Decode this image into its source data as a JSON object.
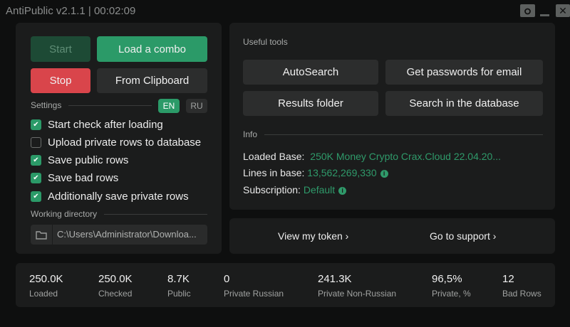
{
  "window": {
    "title": "AntiPublic v2.1.1 | 00:02:09",
    "minimize": "_",
    "close": "✕"
  },
  "left": {
    "start": "Start",
    "load_combo": "Load a combo",
    "stop": "Stop",
    "from_clipboard": "From Clipboard",
    "settings_label": "Settings",
    "lang_en": "EN",
    "lang_ru": "RU",
    "active_lang": "EN",
    "checkboxes": [
      {
        "label": "Start check after loading",
        "checked": true
      },
      {
        "label": "Upload private rows to database",
        "checked": false
      },
      {
        "label": "Save public rows",
        "checked": true
      },
      {
        "label": "Save bad rows",
        "checked": true
      },
      {
        "label": "Additionally save private rows",
        "checked": true
      }
    ],
    "working_dir_label": "Working directory",
    "working_dir": "C:\\Users\\Administrator\\Downloa..."
  },
  "tools": {
    "label": "Useful tools",
    "autosearch": "AutoSearch",
    "get_passwords": "Get passwords for email",
    "results_folder": "Results folder",
    "search_db": "Search in the database"
  },
  "info": {
    "label": "Info",
    "loaded_base_label": "Loaded Base:",
    "loaded_base": "250K Money Crypto Crax.Cloud 22.04.20...",
    "lines_label": "Lines in base:",
    "lines": "13,562,269,330",
    "subscription_label": "Subscription:",
    "subscription": "Default"
  },
  "links": {
    "token": "View my token ›",
    "support": "Go to support ›"
  },
  "stats": [
    {
      "value": "250.0K",
      "label": "Loaded",
      "green": false
    },
    {
      "value": "250.0K",
      "label": "Checked",
      "green": false
    },
    {
      "value": "8.7K",
      "label": "Public",
      "green": false
    },
    {
      "value": "0",
      "label": "Private Russian",
      "green": true
    },
    {
      "value": "241.3K",
      "label": "Private Non-Russian",
      "green": true
    },
    {
      "value": "96,5%",
      "label": "Private, %",
      "green": false
    },
    {
      "value": "12",
      "label": "Bad Rows",
      "green": false
    }
  ],
  "colors": {
    "accent": "#2b9a68",
    "danger": "#d9454b",
    "panel": "#1b1c1c",
    "background": "#0e0f0f"
  }
}
